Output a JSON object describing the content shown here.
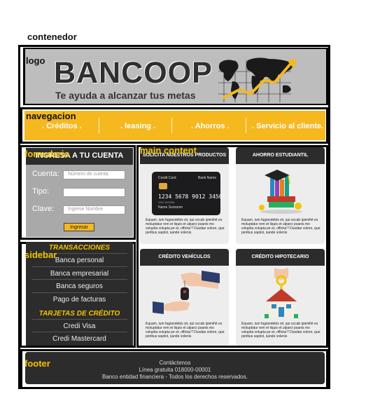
{
  "annotations": {
    "container": "contenedor",
    "logo": "logo",
    "nav": "navegacion",
    "form": "formulario",
    "main": "main content",
    "sidebar": "sidebar",
    "footer": "footer"
  },
  "header": {
    "brand": "BANCOOP",
    "tagline": "Te ayuda a alcanzar tus metas"
  },
  "nav": {
    "items": [
      ". Créditos .",
      ". leasing .",
      ". Ahorros .",
      ". Servicio al cliente."
    ]
  },
  "login": {
    "title": "INGRESA A TU CUENTA",
    "cuenta_label": "Cuenta:",
    "cuenta_placeholder": "Número de cuenta",
    "tipo_label": "Tipo:",
    "clave_label": "Clave:",
    "clave_placeholder": "Ingrese Nombre",
    "button": "Ingresar"
  },
  "sidebar": {
    "cat1": "TRANSACCIONES",
    "items1": [
      "Banca personal",
      "Banca empresarial",
      "Banca seguros",
      "Pago de facturas"
    ],
    "cat2": "TARJETAS DE CRÉDITO",
    "items2": [
      "Credi Visa",
      "Credi Mastercard"
    ]
  },
  "cards": [
    {
      "title": "SOLICITA NUESTROS PRODUCTOS",
      "text": "Equam, ium fugiandebis sit, qui occab ipienihit es moluptatur rem et liquis et ulparci psanis mo volupita volupta pe et, offictur? Dusdae volore, que peribus sapiist, sande volenis"
    },
    {
      "title": "AHORRO ESTUDIANTIL",
      "text": "Equam, ium fugiandebis sit, qui occab ipienihit es moluptatur rem et liquis et ulparci psanis mo volupita volupta pe et, offictur? Dusdae volore, que peribus sapiist, sande volenis"
    },
    {
      "title": "CRÉDITO VEHÍCULOS",
      "text": "Equam, ium fugiandebis sit, qui occab ipienihit es moluptatur rem et liquis et ulparci psanis mo volupita volupta pe et, offictur? Dusdae volore, que peribus sapiist, sande volenis"
    },
    {
      "title": "CRÉDITO HIPOTECARIO",
      "text": "Equam, ium fugiandebis sit, qui occab ipienihit es moluptatur rem et liquis et ulparci psanis mo volupita volupta pe et, offictur? Dusdae volore, que peribus sapiist, sande volenis"
    }
  ],
  "credit_card": {
    "left": "Credit Card",
    "right": "Bank Name",
    "number": "1234 5678 9012 3456",
    "small": "12/0   12/0180",
    "name": "Name Surname"
  },
  "footer": {
    "line1": "Contáctenos",
    "line2": "Línea gratuita 018000-00001",
    "line3": "Banco entidad financiera -  Todos los derechos reservados."
  },
  "colors": {
    "accent": "#f5b81f",
    "dark": "#2c2c2c",
    "header_bg": "#bdbdbd"
  }
}
